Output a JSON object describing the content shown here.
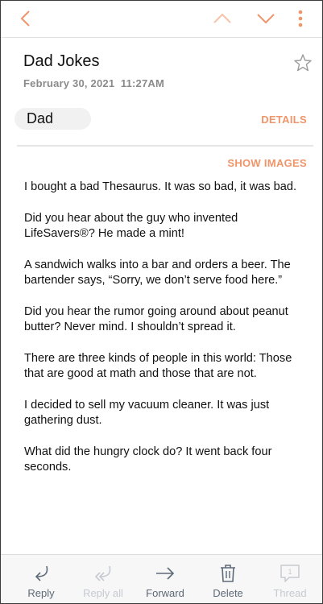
{
  "colors": {
    "accent": "#f0956a",
    "muted": "#8a8a8a",
    "toolbar_text": "#5e6a78",
    "disabled": "#c5cad0"
  },
  "topbar": {
    "back_icon": "chevron-left-icon",
    "prev_icon": "chevron-up-icon",
    "next_icon": "chevron-down-icon",
    "more_icon": "more-vertical-icon"
  },
  "message": {
    "subject": "Dad Jokes",
    "date": "February 30, 2021  11:27AM",
    "sender": "Dad",
    "details_label": "DETAILS",
    "show_images_label": "SHOW IMAGES",
    "paragraphs": [
      "I bought a bad Thesaurus. It was so bad, it was bad.",
      "Did you hear about the guy who invented LifeSavers®? He made a mint!",
      "A sandwich walks into a bar and orders a beer. The bartender says, “Sorry, we don’t serve food here.”",
      "Did you hear the rumor going around about peanut butter? Never mind. I shouldn’t spread it.",
      "There are three kinds of people in this world: Those that are good at math and those that are not.",
      "I decided to sell my vacuum cleaner. It was just gathering dust.",
      "What did the hungry clock do? It went back four seconds."
    ]
  },
  "toolbar": {
    "reply": "Reply",
    "reply_all": "Reply all",
    "forward": "Forward",
    "delete": "Delete",
    "thread": "Thread",
    "thread_count": "1"
  }
}
